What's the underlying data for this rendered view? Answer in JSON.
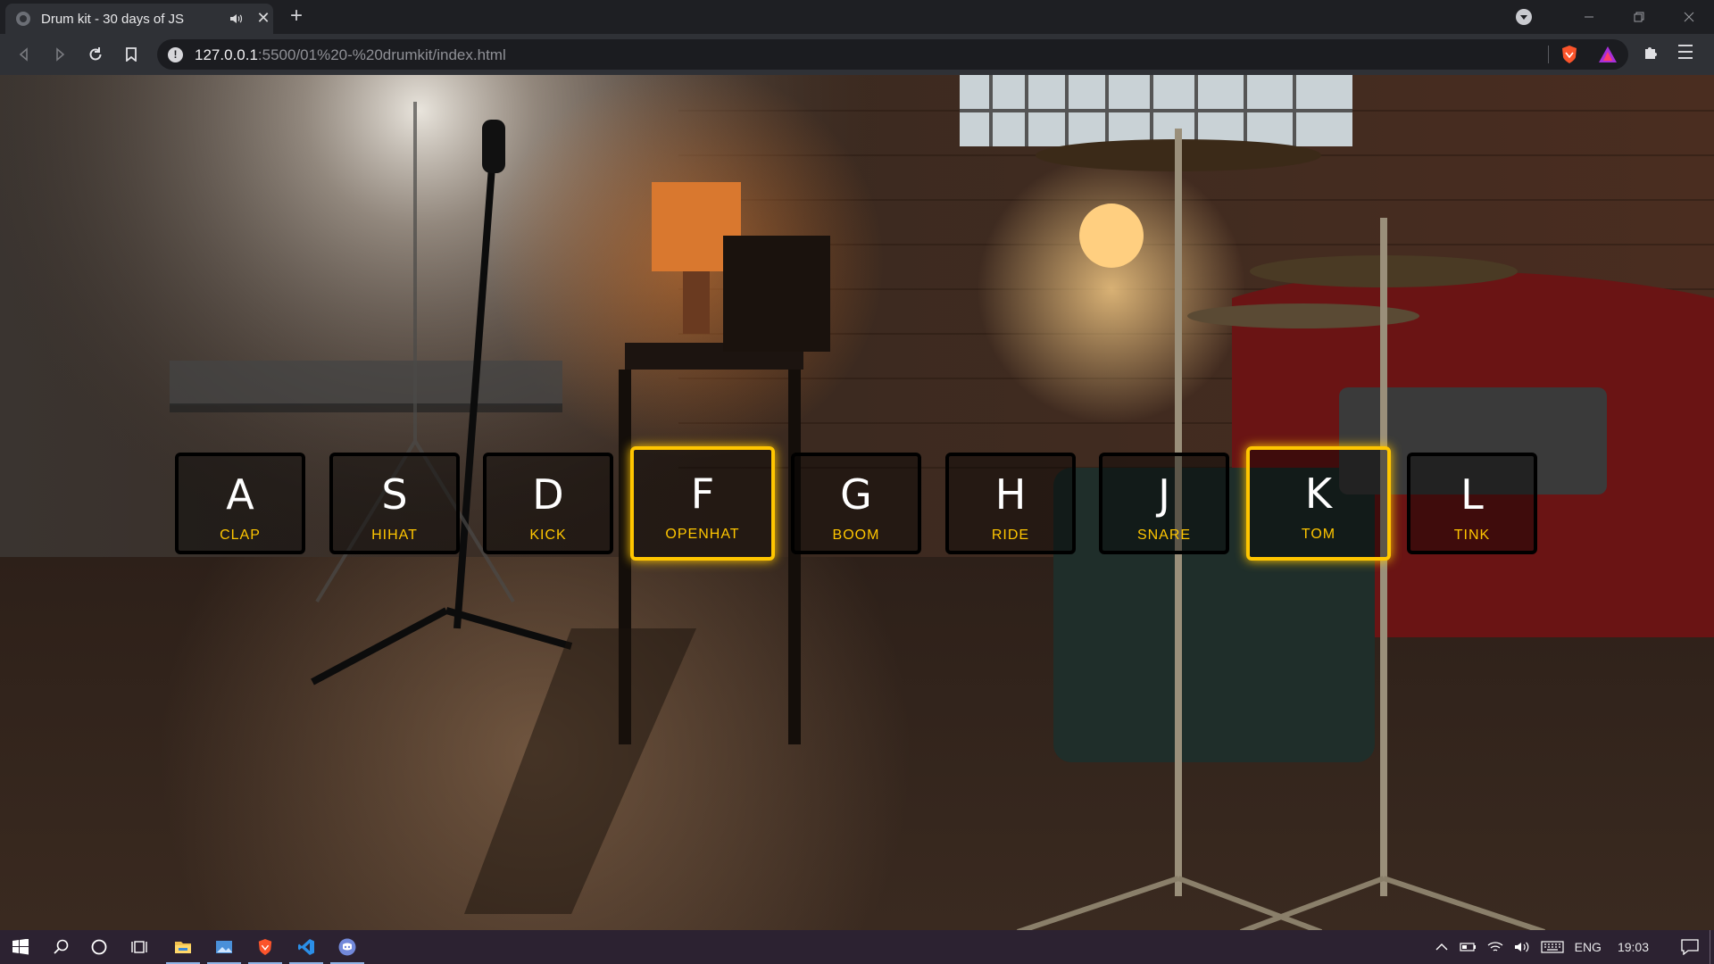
{
  "browser": {
    "tab_title": "Drum kit - 30 days of JS",
    "url_host": "127.0.0.1",
    "url_path": ":5500/01%20-%20drumkit/index.html",
    "new_tab_label": "+",
    "tab_close_label": "✕"
  },
  "drumkit": {
    "keys": [
      {
        "key": "A",
        "sound": "CLAP",
        "playing": false
      },
      {
        "key": "S",
        "sound": "HIHAT",
        "playing": false
      },
      {
        "key": "D",
        "sound": "KICK",
        "playing": false
      },
      {
        "key": "F",
        "sound": "OPENHAT",
        "playing": true
      },
      {
        "key": "G",
        "sound": "BOOM",
        "playing": false
      },
      {
        "key": "H",
        "sound": "RIDE",
        "playing": false
      },
      {
        "key": "J",
        "sound": "SNARE",
        "playing": false
      },
      {
        "key": "K",
        "sound": "TOM",
        "playing": true
      },
      {
        "key": "L",
        "sound": "TINK",
        "playing": false
      }
    ],
    "accent_color": "#ffc600"
  },
  "taskbar": {
    "apps": [
      "start-icon",
      "search-icon",
      "cortana-icon",
      "task-view-icon",
      "file-explorer-icon",
      "photos-icon",
      "brave-icon",
      "vscode-icon",
      "discord-icon"
    ],
    "language": "ENG",
    "time": "19:03"
  }
}
